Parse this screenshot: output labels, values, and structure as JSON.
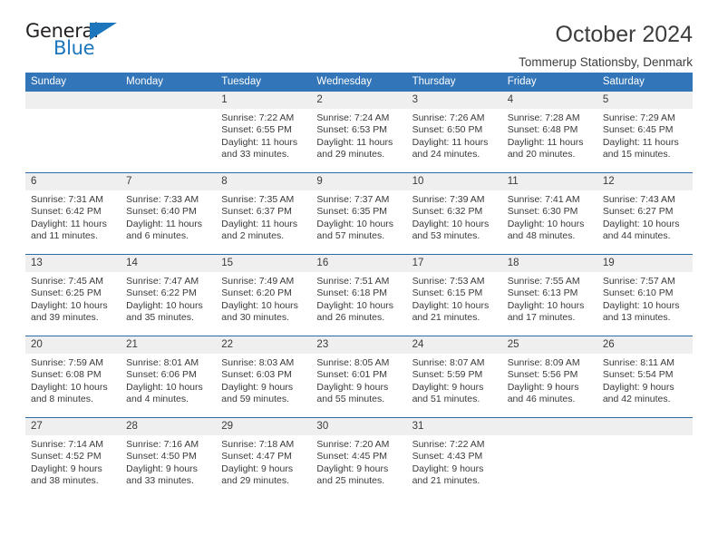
{
  "brand": {
    "word_one": "General",
    "word_two": "Blue",
    "accent_color": "#1d76bb",
    "dark_color": "#231f20"
  },
  "header": {
    "title": "October 2024",
    "subtitle": "Tommerup Stationsby, Denmark"
  },
  "theme": {
    "header_blue": "#3275b8",
    "row_divider": "#2a6ca8",
    "daynum_band": "#efeff0"
  },
  "weekdays": [
    "Sunday",
    "Monday",
    "Tuesday",
    "Wednesday",
    "Thursday",
    "Friday",
    "Saturday"
  ],
  "weeks": [
    [
      {
        "day": ""
      },
      {
        "day": ""
      },
      {
        "day": "1",
        "sunrise": "Sunrise: 7:22 AM",
        "sunset": "Sunset: 6:55 PM",
        "daylight": "Daylight: 11 hours and 33 minutes."
      },
      {
        "day": "2",
        "sunrise": "Sunrise: 7:24 AM",
        "sunset": "Sunset: 6:53 PM",
        "daylight": "Daylight: 11 hours and 29 minutes."
      },
      {
        "day": "3",
        "sunrise": "Sunrise: 7:26 AM",
        "sunset": "Sunset: 6:50 PM",
        "daylight": "Daylight: 11 hours and 24 minutes."
      },
      {
        "day": "4",
        "sunrise": "Sunrise: 7:28 AM",
        "sunset": "Sunset: 6:48 PM",
        "daylight": "Daylight: 11 hours and 20 minutes."
      },
      {
        "day": "5",
        "sunrise": "Sunrise: 7:29 AM",
        "sunset": "Sunset: 6:45 PM",
        "daylight": "Daylight: 11 hours and 15 minutes."
      }
    ],
    [
      {
        "day": "6",
        "sunrise": "Sunrise: 7:31 AM",
        "sunset": "Sunset: 6:42 PM",
        "daylight": "Daylight: 11 hours and 11 minutes."
      },
      {
        "day": "7",
        "sunrise": "Sunrise: 7:33 AM",
        "sunset": "Sunset: 6:40 PM",
        "daylight": "Daylight: 11 hours and 6 minutes."
      },
      {
        "day": "8",
        "sunrise": "Sunrise: 7:35 AM",
        "sunset": "Sunset: 6:37 PM",
        "daylight": "Daylight: 11 hours and 2 minutes."
      },
      {
        "day": "9",
        "sunrise": "Sunrise: 7:37 AM",
        "sunset": "Sunset: 6:35 PM",
        "daylight": "Daylight: 10 hours and 57 minutes."
      },
      {
        "day": "10",
        "sunrise": "Sunrise: 7:39 AM",
        "sunset": "Sunset: 6:32 PM",
        "daylight": "Daylight: 10 hours and 53 minutes."
      },
      {
        "day": "11",
        "sunrise": "Sunrise: 7:41 AM",
        "sunset": "Sunset: 6:30 PM",
        "daylight": "Daylight: 10 hours and 48 minutes."
      },
      {
        "day": "12",
        "sunrise": "Sunrise: 7:43 AM",
        "sunset": "Sunset: 6:27 PM",
        "daylight": "Daylight: 10 hours and 44 minutes."
      }
    ],
    [
      {
        "day": "13",
        "sunrise": "Sunrise: 7:45 AM",
        "sunset": "Sunset: 6:25 PM",
        "daylight": "Daylight: 10 hours and 39 minutes."
      },
      {
        "day": "14",
        "sunrise": "Sunrise: 7:47 AM",
        "sunset": "Sunset: 6:22 PM",
        "daylight": "Daylight: 10 hours and 35 minutes."
      },
      {
        "day": "15",
        "sunrise": "Sunrise: 7:49 AM",
        "sunset": "Sunset: 6:20 PM",
        "daylight": "Daylight: 10 hours and 30 minutes."
      },
      {
        "day": "16",
        "sunrise": "Sunrise: 7:51 AM",
        "sunset": "Sunset: 6:18 PM",
        "daylight": "Daylight: 10 hours and 26 minutes."
      },
      {
        "day": "17",
        "sunrise": "Sunrise: 7:53 AM",
        "sunset": "Sunset: 6:15 PM",
        "daylight": "Daylight: 10 hours and 21 minutes."
      },
      {
        "day": "18",
        "sunrise": "Sunrise: 7:55 AM",
        "sunset": "Sunset: 6:13 PM",
        "daylight": "Daylight: 10 hours and 17 minutes."
      },
      {
        "day": "19",
        "sunrise": "Sunrise: 7:57 AM",
        "sunset": "Sunset: 6:10 PM",
        "daylight": "Daylight: 10 hours and 13 minutes."
      }
    ],
    [
      {
        "day": "20",
        "sunrise": "Sunrise: 7:59 AM",
        "sunset": "Sunset: 6:08 PM",
        "daylight": "Daylight: 10 hours and 8 minutes."
      },
      {
        "day": "21",
        "sunrise": "Sunrise: 8:01 AM",
        "sunset": "Sunset: 6:06 PM",
        "daylight": "Daylight: 10 hours and 4 minutes."
      },
      {
        "day": "22",
        "sunrise": "Sunrise: 8:03 AM",
        "sunset": "Sunset: 6:03 PM",
        "daylight": "Daylight: 9 hours and 59 minutes."
      },
      {
        "day": "23",
        "sunrise": "Sunrise: 8:05 AM",
        "sunset": "Sunset: 6:01 PM",
        "daylight": "Daylight: 9 hours and 55 minutes."
      },
      {
        "day": "24",
        "sunrise": "Sunrise: 8:07 AM",
        "sunset": "Sunset: 5:59 PM",
        "daylight": "Daylight: 9 hours and 51 minutes."
      },
      {
        "day": "25",
        "sunrise": "Sunrise: 8:09 AM",
        "sunset": "Sunset: 5:56 PM",
        "daylight": "Daylight: 9 hours and 46 minutes."
      },
      {
        "day": "26",
        "sunrise": "Sunrise: 8:11 AM",
        "sunset": "Sunset: 5:54 PM",
        "daylight": "Daylight: 9 hours and 42 minutes."
      }
    ],
    [
      {
        "day": "27",
        "sunrise": "Sunrise: 7:14 AM",
        "sunset": "Sunset: 4:52 PM",
        "daylight": "Daylight: 9 hours and 38 minutes."
      },
      {
        "day": "28",
        "sunrise": "Sunrise: 7:16 AM",
        "sunset": "Sunset: 4:50 PM",
        "daylight": "Daylight: 9 hours and 33 minutes."
      },
      {
        "day": "29",
        "sunrise": "Sunrise: 7:18 AM",
        "sunset": "Sunset: 4:47 PM",
        "daylight": "Daylight: 9 hours and 29 minutes."
      },
      {
        "day": "30",
        "sunrise": "Sunrise: 7:20 AM",
        "sunset": "Sunset: 4:45 PM",
        "daylight": "Daylight: 9 hours and 25 minutes."
      },
      {
        "day": "31",
        "sunrise": "Sunrise: 7:22 AM",
        "sunset": "Sunset: 4:43 PM",
        "daylight": "Daylight: 9 hours and 21 minutes."
      },
      {
        "day": ""
      },
      {
        "day": ""
      }
    ]
  ]
}
